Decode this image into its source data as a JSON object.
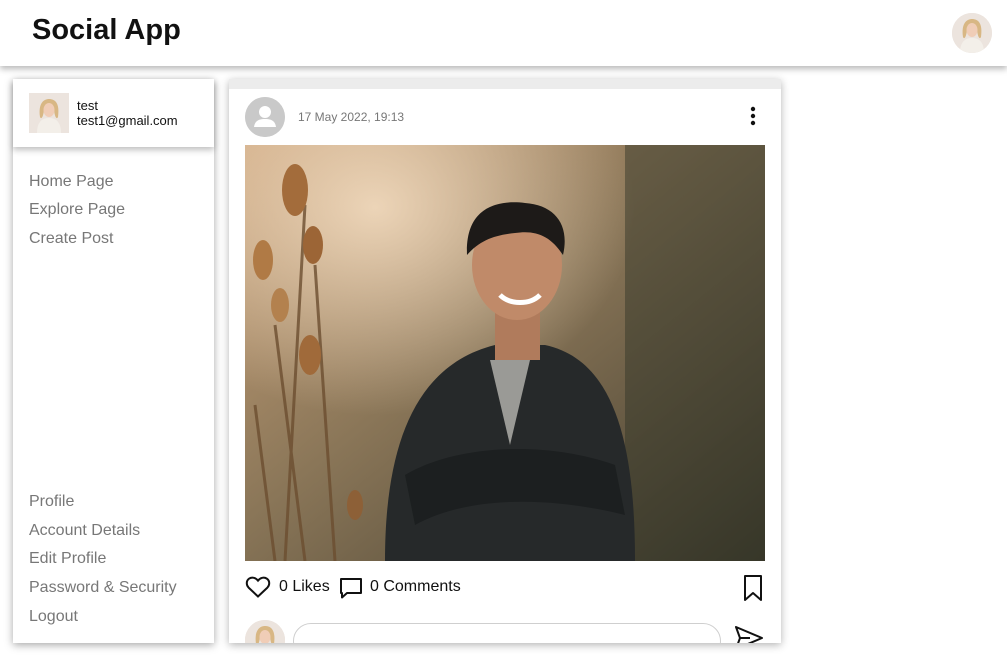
{
  "app": {
    "title": "Social App"
  },
  "user": {
    "name": "test",
    "email": "test1@gmail.com"
  },
  "sidebar": {
    "top_items": [
      {
        "label": "Home Page"
      },
      {
        "label": "Explore Page"
      },
      {
        "label": "Create Post"
      }
    ],
    "bottom_items": [
      {
        "label": "Profile"
      },
      {
        "label": "Account Details"
      },
      {
        "label": "Edit Profile"
      },
      {
        "label": "Password & Security"
      },
      {
        "label": "Logout"
      }
    ]
  },
  "post": {
    "date": "17 May 2022, 19:13",
    "likes_label": "0 Likes",
    "comments_label": "0 Comments",
    "comment_placeholder": ""
  },
  "icons": {
    "top_avatar": "user-avatar-icon",
    "post_menu": "more-vertical-icon",
    "like": "heart-outline-icon",
    "comment": "comment-bubble-icon",
    "save": "bookmark-outline-icon",
    "send": "send-icon"
  },
  "colors": {
    "nav_text": "#777777",
    "default_avatar": "#c9c9c9",
    "text": "#111111"
  }
}
